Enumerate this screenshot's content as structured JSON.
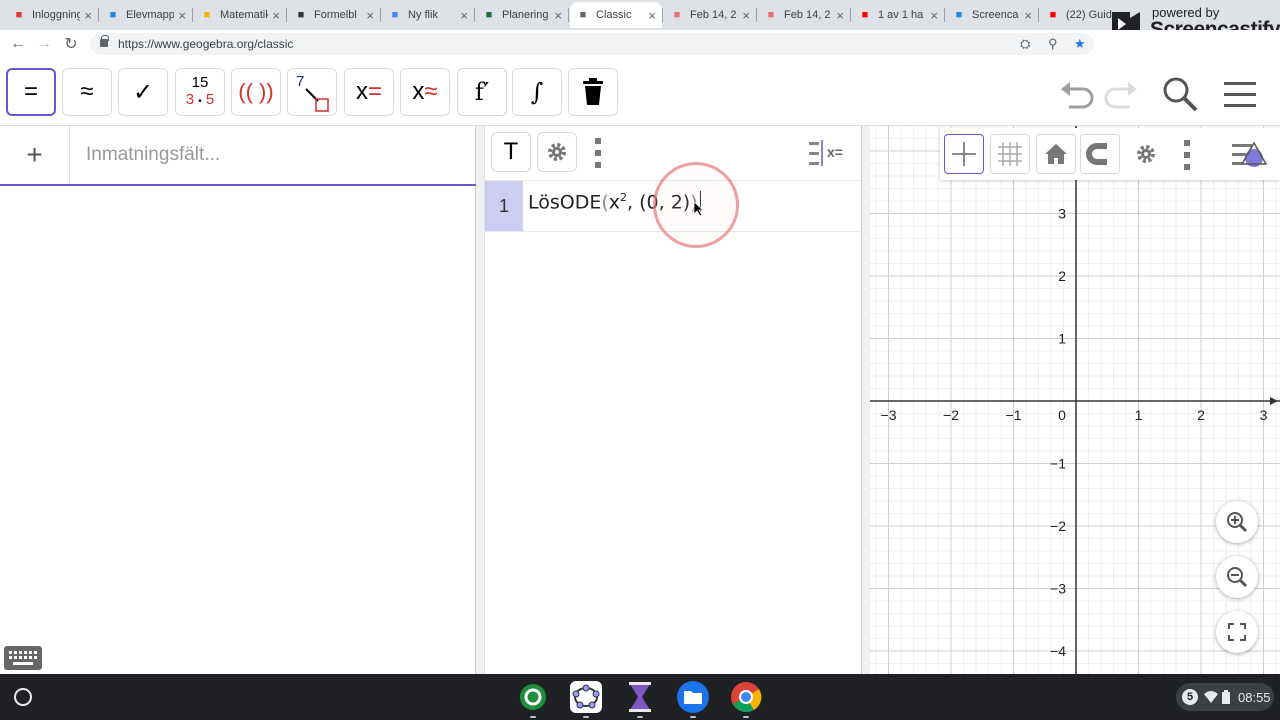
{
  "browser": {
    "tabs": [
      {
        "title": "Inloggning",
        "favicon": "heart-icon",
        "color": "#e53935"
      },
      {
        "title": "Elevmapp",
        "favicon": "drive-icon",
        "color": "#1e88e5"
      },
      {
        "title": "Matematik",
        "favicon": "slides-icon",
        "color": "#f4b400"
      },
      {
        "title": "Formelbl",
        "favicon": "crest-icon",
        "color": "#333333"
      },
      {
        "title": "Ny flik",
        "favicon": "google-icon",
        "color": "#4285f4"
      },
      {
        "title": "Planering",
        "favicon": "excel-icon",
        "color": "#1d6f42"
      },
      {
        "title": "Classic",
        "favicon": "geogebra-icon",
        "color": "#666666",
        "active": true
      },
      {
        "title": "Feb 14, 2",
        "favicon": "screencastify-icon",
        "color": "#e57373"
      },
      {
        "title": "Feb 14, 2",
        "favicon": "screencastify-icon",
        "color": "#e57373"
      },
      {
        "title": "1 av 1 ha",
        "favicon": "youtube-icon",
        "color": "#ff0000"
      },
      {
        "title": "Screenca",
        "favicon": "drive-icon",
        "color": "#1e88e5"
      },
      {
        "title": "(22) Guid",
        "favicon": "youtube-icon",
        "color": "#ff0000"
      }
    ],
    "url": "https://www.geogebra.org/classic",
    "watermark": {
      "small": "powered by",
      "big": "Screencastify"
    }
  },
  "toolbar": {
    "tools": [
      {
        "name": "evaluate-tool",
        "label": "="
      },
      {
        "name": "numeric-tool",
        "label": "≈"
      },
      {
        "name": "keep-input-tool",
        "label": "✓"
      },
      {
        "name": "factor-tool",
        "top": "15",
        "bottom_a": "3",
        "bottom_dot": "•",
        "bottom_b": "5"
      },
      {
        "name": "expand-tool",
        "label": "(( ))"
      },
      {
        "name": "substitute-tool",
        "label": "7"
      },
      {
        "name": "solve-tool",
        "label": "x",
        "suffix": "="
      },
      {
        "name": "solve-numerically-tool",
        "label": "x",
        "suffix": "≈"
      },
      {
        "name": "derivative-tool",
        "label": "f′"
      },
      {
        "name": "integral-tool",
        "label": "∫"
      },
      {
        "name": "delete-tool",
        "label": ""
      }
    ]
  },
  "algebra": {
    "plus": "+",
    "input_placeholder": "Inmatningsfält..."
  },
  "cas": {
    "text_tool": "T",
    "toggle_label": "x=",
    "rows": [
      {
        "number": "1",
        "cmd": "LösODE",
        "arg_base": "x",
        "arg_exp": "2",
        "point": "(0, 2)"
      }
    ]
  },
  "graphics": {
    "x_labels": [
      "−3",
      "−2",
      "−1",
      "0",
      "1",
      "2",
      "3"
    ],
    "y_labels": [
      "3",
      "2",
      "1",
      "−1",
      "−2",
      "−3",
      "−4"
    ],
    "x_range": [
      -3,
      3
    ],
    "y_range": [
      -4,
      3
    ]
  },
  "shelf": {
    "time": "08:55",
    "notification_count": "5"
  }
}
